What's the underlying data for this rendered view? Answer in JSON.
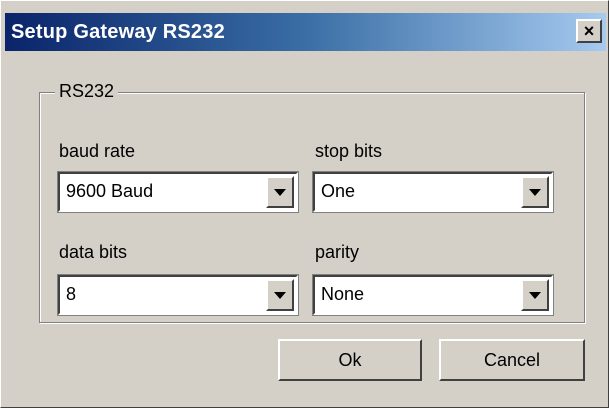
{
  "window": {
    "title": "Setup Gateway RS232",
    "close_glyph": "×",
    "close_icon": "close-icon"
  },
  "group": {
    "label": "RS232"
  },
  "fields": {
    "baud_rate": {
      "label": "baud rate",
      "value": "9600 Baud"
    },
    "stop_bits": {
      "label": "stop bits",
      "value": "One"
    },
    "data_bits": {
      "label": "data bits",
      "value": "8"
    },
    "parity": {
      "label": "parity",
      "value": "None"
    }
  },
  "buttons": {
    "ok_label": "Ok",
    "cancel_label": "Cancel"
  },
  "colors": {
    "dialog_bg": "#d4d0c8",
    "title_start": "#0a246a",
    "title_end": "#a6caf0"
  }
}
